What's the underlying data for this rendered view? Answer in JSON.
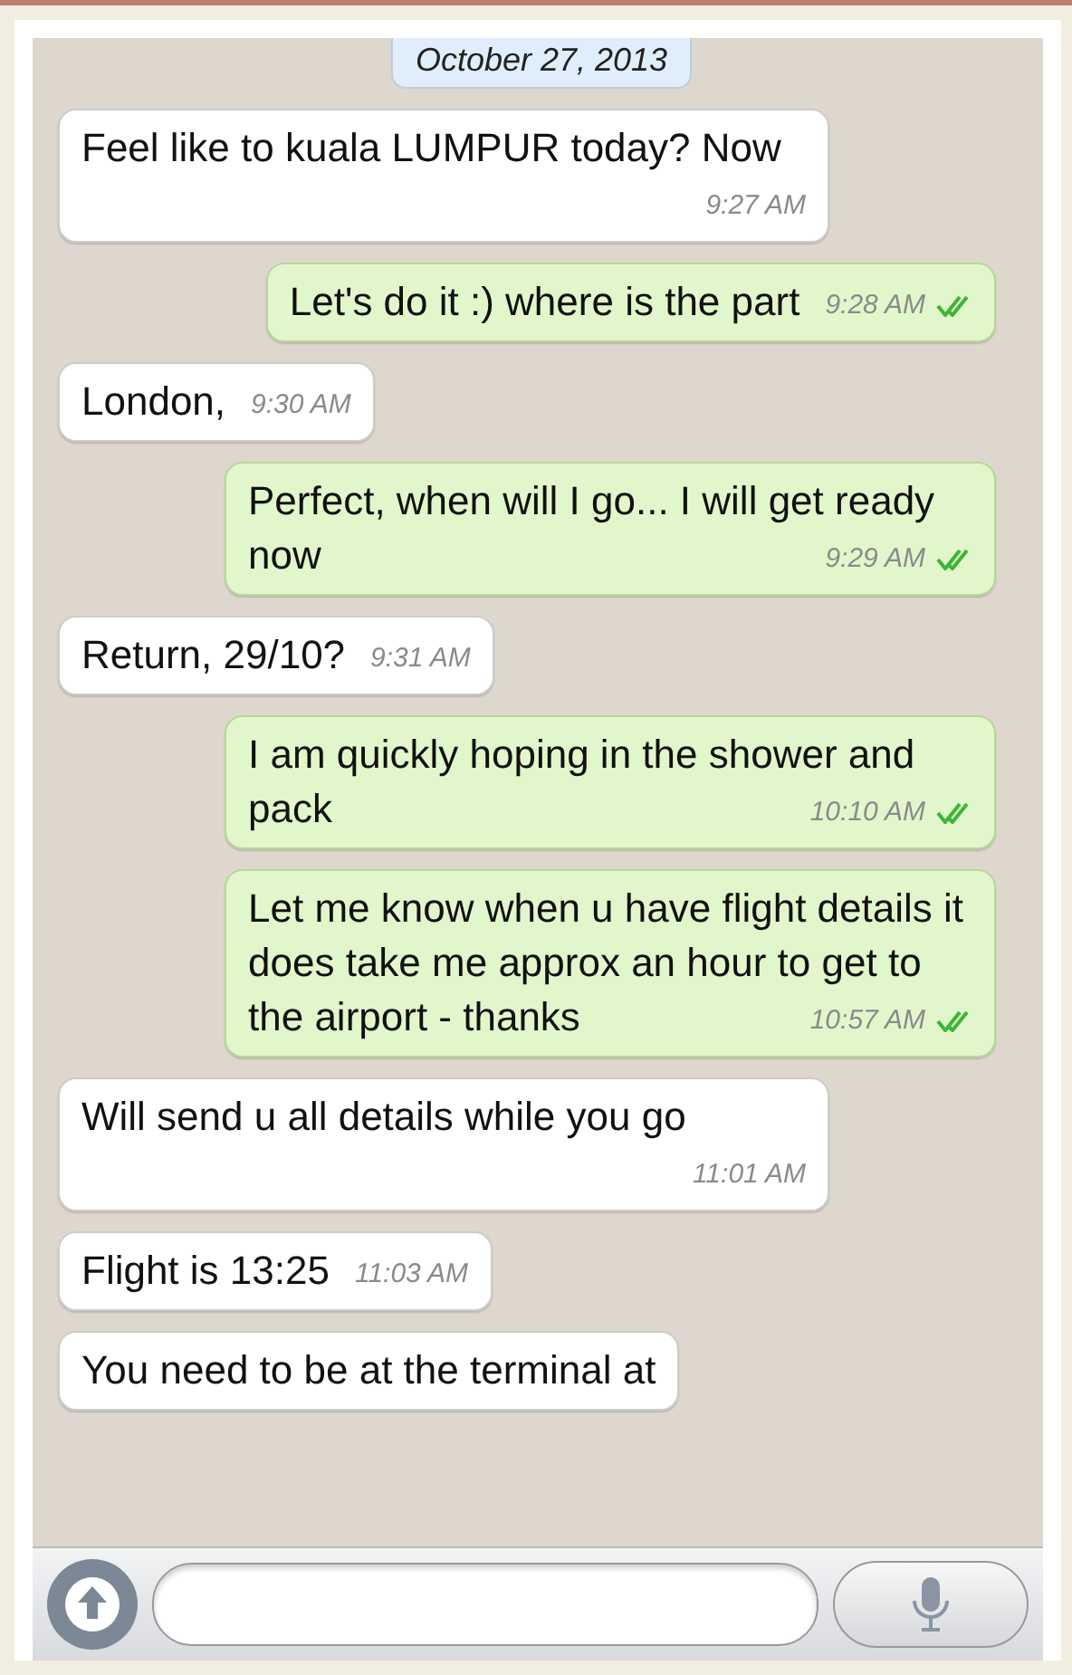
{
  "date_label": "October 27, 2013",
  "messages": [
    {
      "kind": "in",
      "text": "Feel like to kuala LUMPUR today? Now",
      "time": "9:27 AM"
    },
    {
      "kind": "out",
      "text": "Let's do it :) where is the part",
      "time": "9:28 AM",
      "read": true
    },
    {
      "kind": "in",
      "text": "London,",
      "time": "9:30 AM"
    },
    {
      "kind": "out",
      "text": "Perfect, when will I go... I will get ready now",
      "time": "9:29 AM",
      "read": true
    },
    {
      "kind": "in",
      "text": "Return, 29/10?",
      "time": "9:31 AM"
    },
    {
      "kind": "out",
      "text": "I am quickly hoping in the shower and pack",
      "time": "10:10 AM",
      "read": true
    },
    {
      "kind": "out",
      "text": "Let me know when u have flight details it does take me approx an hour to get to the airport - thanks",
      "time": "10:57 AM",
      "read": true
    },
    {
      "kind": "in",
      "text": "Will send u all details while you go",
      "time": "11:01 AM"
    },
    {
      "kind": "in",
      "text": "Flight is 13:25",
      "time": "11:03 AM"
    },
    {
      "kind": "in",
      "text": "You need to be at the terminal at"
    }
  ]
}
